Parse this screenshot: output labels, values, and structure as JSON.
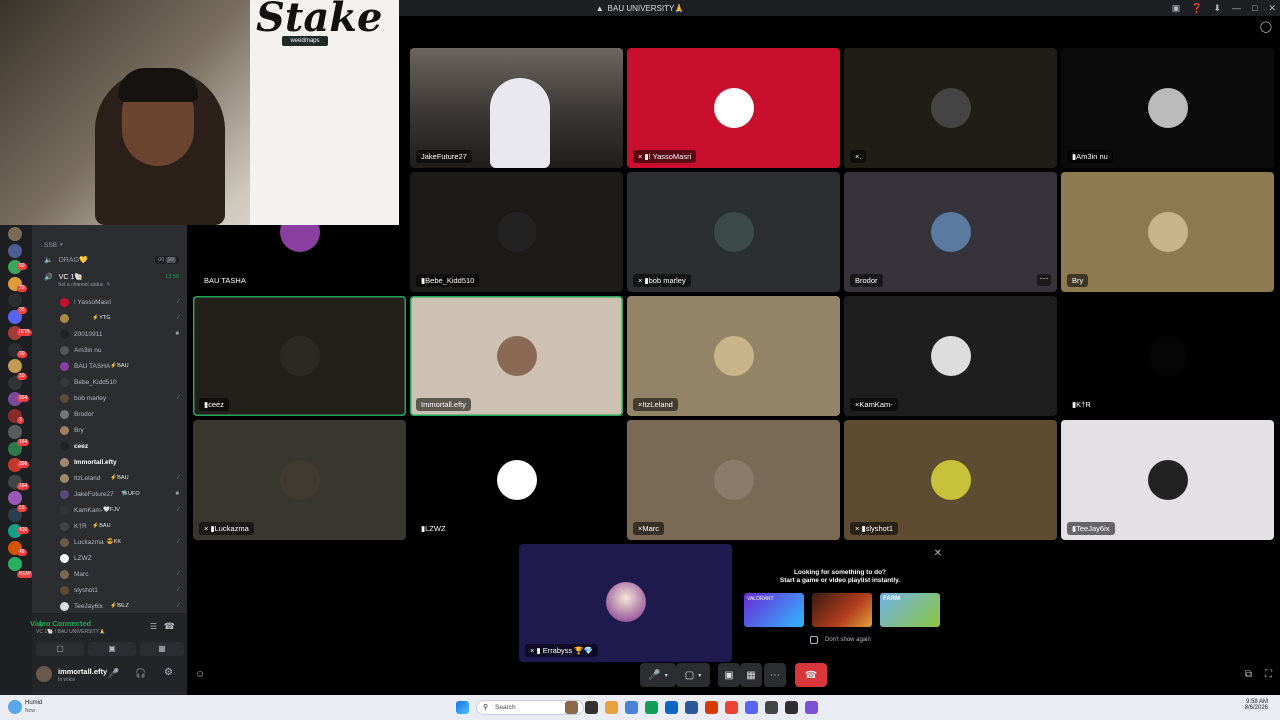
{
  "window": {
    "title": "BAU UNIVERSITY🙏"
  },
  "webcam": {
    "brand": "Stake",
    "sticker": "weedmaps"
  },
  "channels": {
    "category": "SSB",
    "drag_channel": "DRAG💛",
    "drag_count": "00",
    "drag_limit": "99",
    "vc_channel": "VC 1🐚",
    "vc_timer": "13:56",
    "channel_status": "Set a channel status",
    "members": [
      {
        "name": "! YassoMasri",
        "tag": "",
        "icon": "deafened-icon",
        "color": "#b5bac1"
      },
      {
        "name": "",
        "tag": "⚡YTG",
        "icon": "deafened-icon",
        "color": "#b5bac1"
      },
      {
        "name": "20010911",
        "tag": "",
        "icon": "camera-icon",
        "color": "#b5bac1"
      },
      {
        "name": "Am3in nu",
        "tag": "",
        "icon": "",
        "color": "#b5bac1"
      },
      {
        "name": "BAU TASHA",
        "tag": "⚡BAU",
        "icon": "",
        "color": "#b5bac1"
      },
      {
        "name": "Bebe_Kidd510",
        "tag": "",
        "icon": "",
        "color": "#b5bac1"
      },
      {
        "name": "bob marley",
        "tag": "",
        "icon": "deafened-icon",
        "color": "#b5bac1"
      },
      {
        "name": "Brodor",
        "tag": "",
        "icon": "",
        "color": "#b5bac1"
      },
      {
        "name": "Bry",
        "tag": "",
        "icon": "",
        "color": "#b5bac1"
      },
      {
        "name": "ceez",
        "tag": "",
        "icon": "",
        "color": "#ffffff"
      },
      {
        "name": "Immortall.efty",
        "tag": "",
        "icon": "",
        "color": "#ffffff"
      },
      {
        "name": "ItzLeland",
        "tag": "⚡BAU",
        "icon": "deafened-icon",
        "color": "#b5bac1"
      },
      {
        "name": "JakeFuture27",
        "tag": "🛸UFO",
        "icon": "camera-icon",
        "color": "#b5bac1"
      },
      {
        "name": "KamKam-",
        "tag": "🤍FJV",
        "icon": "deafened-icon",
        "color": "#b5bac1"
      },
      {
        "name": "K†R",
        "tag": "⚡BAU",
        "icon": "",
        "color": "#b5bac1"
      },
      {
        "name": "Luckazma",
        "tag": "😎KK",
        "icon": "deafened-icon",
        "color": "#b5bac1"
      },
      {
        "name": "LZWZ",
        "tag": "",
        "icon": "",
        "color": "#b5bac1"
      },
      {
        "name": "Marc",
        "tag": "",
        "icon": "deafened-icon",
        "color": "#b5bac1"
      },
      {
        "name": "slyshot1",
        "tag": "",
        "icon": "deafened-icon",
        "color": "#b5bac1"
      },
      {
        "name": "TeeJay6ix",
        "tag": "⚡BILZ",
        "icon": "deafened-icon",
        "color": "#b5bac1"
      }
    ]
  },
  "servers": {
    "badges": [
      "60",
      "39",
      "35",
      "IXTA",
      "20",
      "10",
      "564",
      "3",
      "164",
      "286",
      "164",
      "53",
      "430",
      "46",
      "NEW"
    ]
  },
  "voice_panel": {
    "status": "Video Connected",
    "location": "VC 1🐚 / BAU UNIVERSITY🙏",
    "username": "immortall.efty",
    "user_status": "In voice"
  },
  "tiles": [
    {
      "name": "JakeFuture27",
      "bg": "#3c3a38",
      "ring": false,
      "icons": ""
    },
    {
      "name": "! YassoMasri",
      "bg": "#c8102e",
      "ring": false,
      "icons": "× ▮"
    },
    {
      "name": ".",
      "bg": "#1e1e16",
      "ring": false,
      "icons": "×"
    },
    {
      "name": "Am3in nu",
      "bg": "#0b0b0b",
      "ring": false,
      "icons": "▮"
    },
    {
      "name": "BAU TASHA",
      "bg": "#000000",
      "ring": false,
      "icons": ""
    },
    {
      "name": "Bebe_Kidd510",
      "bg": "#1c1a16",
      "ring": false,
      "icons": "▮"
    },
    {
      "name": "bob marley",
      "bg": "#2c2f30",
      "ring": false,
      "icons": "× ▮"
    },
    {
      "name": "Brodor",
      "bg": "#36343a",
      "ring": false,
      "icons": ""
    },
    {
      "name": "Bry",
      "bg": "#8d7a50",
      "ring": false,
      "icons": ""
    },
    {
      "name": "ceez",
      "bg": "#231f1a",
      "ring": true,
      "icons": "▮"
    },
    {
      "name": "Immortall.efty",
      "bg": "#cdc1b3",
      "ring": true,
      "icons": ""
    },
    {
      "name": "ItzLeland",
      "bg": "#938468",
      "ring": false,
      "icons": "×"
    },
    {
      "name": "KamKam-",
      "bg": "#1e1e1e",
      "ring": false,
      "icons": "×"
    },
    {
      "name": "K†R",
      "bg": "#000000",
      "ring": false,
      "icons": "▮"
    },
    {
      "name": "Luckazma",
      "bg": "#38372f",
      "ring": false,
      "icons": "× ▮"
    },
    {
      "name": "LZWZ",
      "bg": "#000000",
      "ring": false,
      "icons": "▮"
    },
    {
      "name": "Marc",
      "bg": "#7a6a55",
      "ring": false,
      "icons": "×"
    },
    {
      "name": "slyshot1",
      "bg": "#5e4c32",
      "ring": false,
      "icons": "× ▮"
    },
    {
      "name": "TeeJay6ix",
      "bg": "#e3e1e4",
      "ring": false,
      "icons": "▮"
    }
  ],
  "activity": {
    "name": "Errabyss 🏆💎",
    "icons": "× ▮"
  },
  "promo": {
    "title": "Looking for something to do?",
    "subtitle": "Start a game or video playlist instantly.",
    "dont_show": "Don't show again",
    "thumbs": [
      "VALORANT",
      "",
      "FARM"
    ]
  },
  "taskbar": {
    "weather": "Humid",
    "weather_sub": "Now",
    "search": "Search",
    "time": "9:58 AM",
    "date": "8/6/2026"
  }
}
